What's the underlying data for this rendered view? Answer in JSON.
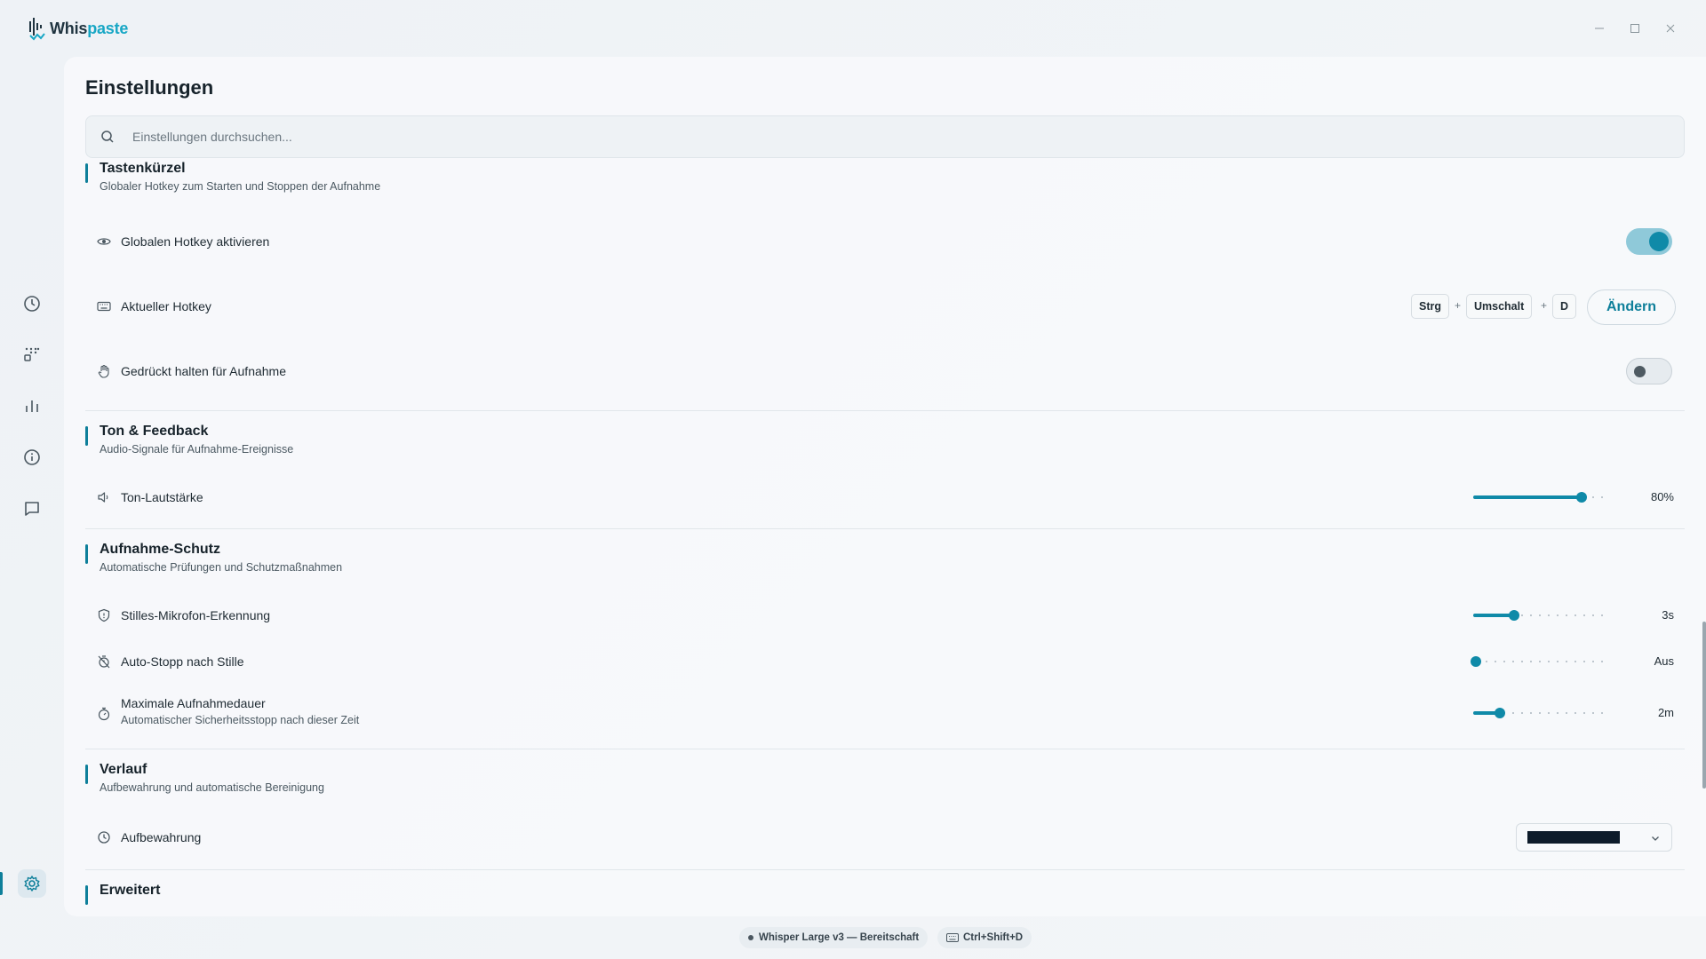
{
  "app": {
    "name_part1": "Whis",
    "name_part2": "paste"
  },
  "window_controls": [
    "minimize-icon",
    "maximize-icon",
    "close-icon"
  ],
  "sidebar": {
    "items": [
      {
        "name": "history",
        "icon": "clock-icon"
      },
      {
        "name": "shortcuts",
        "icon": "grid-icon"
      },
      {
        "name": "statistics",
        "icon": "bar-chart-icon"
      },
      {
        "name": "info",
        "icon": "info-icon"
      },
      {
        "name": "feedback",
        "icon": "chat-icon"
      },
      {
        "name": "settings",
        "icon": "gear-icon",
        "active": true
      }
    ]
  },
  "page": {
    "title": "Einstellungen"
  },
  "search": {
    "placeholder": "Einstellungen durchsuchen...",
    "value": ""
  },
  "sections": {
    "hotkeys": {
      "title": "Tastenkürzel",
      "subtitle": "Globaler Hotkey zum Starten und Stoppen der Aufnahme",
      "rows": {
        "enable": {
          "label": "Globalen Hotkey aktivieren",
          "icon": "eye-icon",
          "toggle": true
        },
        "current": {
          "label": "Aktueller Hotkey",
          "icon": "keyboard-icon",
          "keys": [
            "Strg",
            "Umschalt",
            "D"
          ],
          "separator": "+",
          "button": "Ändern"
        },
        "hold": {
          "label": "Gedrückt halten für Aufnahme",
          "icon": "hand-icon",
          "toggle": false
        }
      }
    },
    "sound": {
      "title": "Ton & Feedback",
      "subtitle": "Audio-Signale für Aufnahme-Ereignisse",
      "rows": {
        "volume": {
          "label": "Ton-Lautstärke",
          "icon": "speaker-icon",
          "level": 0.8,
          "value_text": "80%"
        }
      }
    },
    "protection": {
      "title": "Aufnahme-Schutz",
      "subtitle": "Automatische Prüfungen und Schutzmaßnahmen",
      "rows": {
        "silent_mic": {
          "label": "Stilles-Mikrofon-Erkennung",
          "icon": "shield-icon",
          "level": 0.3,
          "value_text": "3s"
        },
        "auto_stop": {
          "label": "Auto-Stopp nach Stille",
          "icon": "timer-off-icon",
          "level": 0.0,
          "value_text": "Aus"
        },
        "max_duration": {
          "label": "Maximale Aufnahmedauer",
          "sublabel": "Automatischer Sicherheitsstopp nach dieser Zeit",
          "icon": "stopwatch-icon",
          "level": 0.2,
          "value_text": "2m"
        }
      }
    },
    "history": {
      "title": "Verlauf",
      "subtitle": "Aufbewahrung und automatische Bereinigung",
      "rows": {
        "retention": {
          "label": "Aufbewahrung",
          "icon": "clock-icon"
        }
      }
    },
    "advanced": {
      "title": "Erweitert"
    }
  },
  "status_bar": {
    "model_status": "Whisper Large v3 — Bereitschaft",
    "hotkey": "Ctrl+Shift+D"
  },
  "colors": {
    "accent": "#0f8aa8",
    "accent_dark": "#0e7f9a",
    "toggle_on_bg": "#8fc9d9"
  }
}
